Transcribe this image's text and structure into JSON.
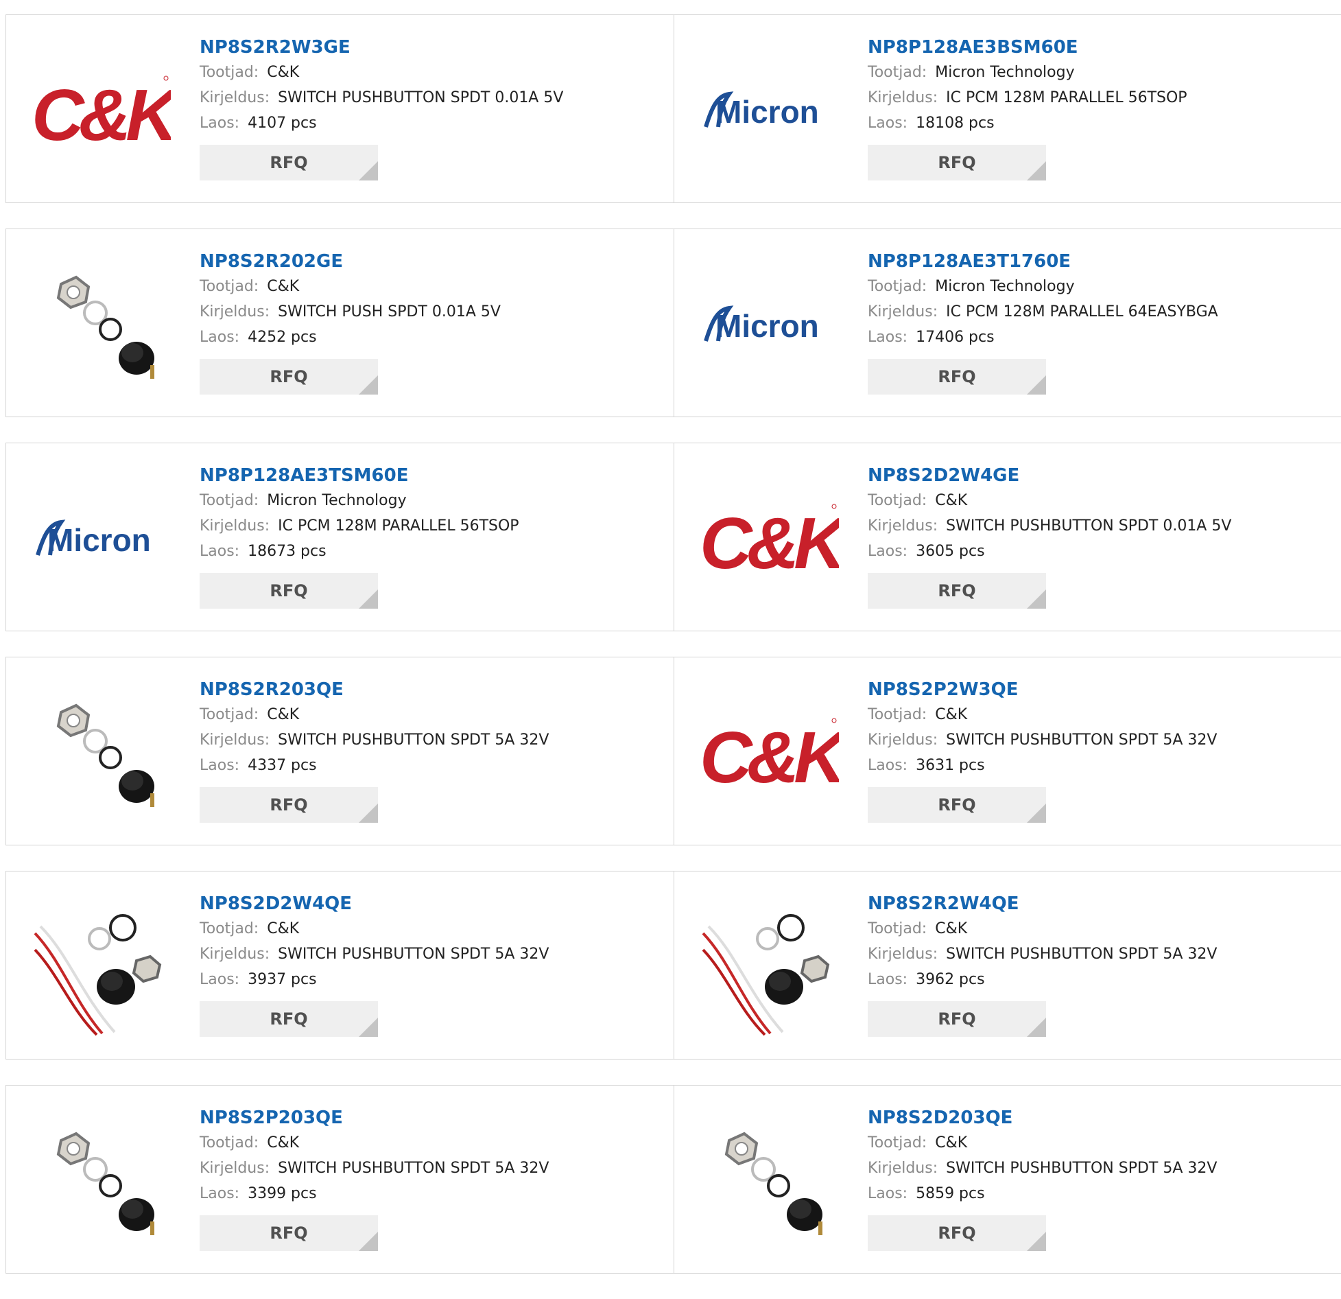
{
  "labels": {
    "manufacturer": "Tootjad:",
    "description": "Kirjeldus:",
    "stock": "Laos:"
  },
  "rfq_label": "RFQ",
  "brand_colors": {
    "ck_red": "#c8202a",
    "micron_blue": "#1e4f96",
    "link_blue": "#1565b0"
  },
  "rows": [
    {
      "left": {
        "part": "NP8S2R2W3GE",
        "manufacturer": "C&K",
        "description": "SWITCH PUSHBUTTON SPDT 0.01A 5V",
        "stock": "4107 pcs",
        "image": "ck-logo"
      },
      "right": {
        "part": "NP8P128AE3BSM60E",
        "manufacturer": "Micron Technology",
        "description": "IC PCM 128M PARALLEL 56TSOP",
        "stock": "18108 pcs",
        "image": "micron-logo"
      }
    },
    {
      "left": {
        "part": "NP8S2R202GE",
        "manufacturer": "C&K",
        "description": "SWITCH PUSH SPDT 0.01A 5V",
        "stock": "4252 pcs",
        "image": "pushbutton-kit-photo"
      },
      "right": {
        "part": "NP8P128AE3T1760E",
        "manufacturer": "Micron Technology",
        "description": "IC PCM 128M PARALLEL 64EASYBGA",
        "stock": "17406 pcs",
        "image": "micron-logo"
      }
    },
    {
      "left": {
        "part": "NP8P128AE3TSM60E",
        "manufacturer": "Micron Technology",
        "description": "IC PCM 128M PARALLEL 56TSOP",
        "stock": "18673 pcs",
        "image": "micron-logo"
      },
      "right": {
        "part": "NP8S2D2W4GE",
        "manufacturer": "C&K",
        "description": "SWITCH PUSHBUTTON SPDT 0.01A 5V",
        "stock": "3605 pcs",
        "image": "ck-logo"
      }
    },
    {
      "left": {
        "part": "NP8S2R203QE",
        "manufacturer": "C&K",
        "description": "SWITCH PUSHBUTTON SPDT 5A 32V",
        "stock": "4337 pcs",
        "image": "pushbutton-kit-photo"
      },
      "right": {
        "part": "NP8S2P2W3QE",
        "manufacturer": "C&K",
        "description": "SWITCH PUSHBUTTON SPDT 5A 32V",
        "stock": "3631 pcs",
        "image": "ck-logo"
      }
    },
    {
      "left": {
        "part": "NP8S2D2W4QE",
        "manufacturer": "C&K",
        "description": "SWITCH PUSHBUTTON SPDT 5A 32V",
        "stock": "3937 pcs",
        "image": "wired-pushbutton-photo"
      },
      "right": {
        "part": "NP8S2R2W4QE",
        "manufacturer": "C&K",
        "description": "SWITCH PUSHBUTTON SPDT 5A 32V",
        "stock": "3962 pcs",
        "image": "wired-pushbutton-photo"
      }
    },
    {
      "left": {
        "part": "NP8S2P203QE",
        "manufacturer": "C&K",
        "description": "SWITCH PUSHBUTTON SPDT 5A 32V",
        "stock": "3399 pcs",
        "image": "pushbutton-kit-photo"
      },
      "right": {
        "part": "NP8S2D203QE",
        "manufacturer": "C&K",
        "description": "SWITCH PUSHBUTTON SPDT 5A 32V",
        "stock": "5859 pcs",
        "image": "pushbutton-kit-photo"
      }
    }
  ]
}
